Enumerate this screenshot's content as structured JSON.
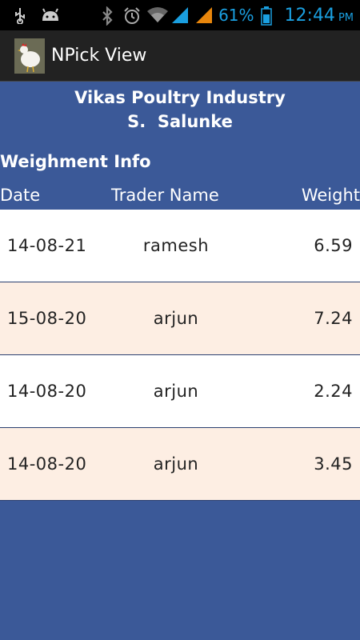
{
  "status_bar": {
    "battery_percent": "61%",
    "time": "12:44",
    "ampm": "PM",
    "accent_color": "#1a9fe0"
  },
  "action_bar": {
    "title": "NPick View"
  },
  "header": {
    "company": "Vikas Poultry Industry",
    "owner": "S.  Salunke"
  },
  "section": {
    "title": "Weighment Info"
  },
  "columns": {
    "date": "Date",
    "trader": "Trader Name",
    "weight": "Weight"
  },
  "rows": [
    {
      "date": "14-08-21",
      "trader": "ramesh",
      "weight": "6.59"
    },
    {
      "date": "15-08-20",
      "trader": "arjun",
      "weight": "7.24"
    },
    {
      "date": "14-08-20",
      "trader": "arjun",
      "weight": "2.24"
    },
    {
      "date": "14-08-20",
      "trader": "arjun",
      "weight": "3.45"
    }
  ],
  "colors": {
    "background": "#3b5998",
    "row_even": "#ffffff",
    "row_odd": "#fdeee3"
  }
}
